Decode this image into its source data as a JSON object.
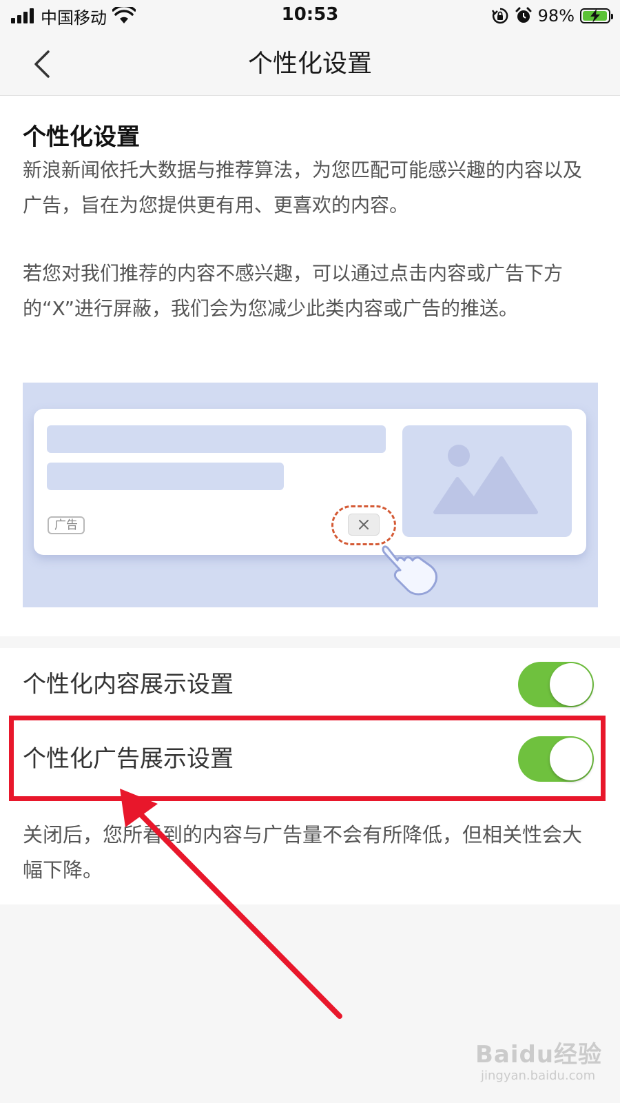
{
  "status_bar": {
    "carrier": "中国移动",
    "time": "10:53",
    "battery_percent": "98%",
    "battery_level": 0.98,
    "icons": [
      "signal-icon",
      "wifi-icon",
      "rotation-lock-icon",
      "alarm-icon",
      "battery-charging-icon"
    ]
  },
  "nav": {
    "title": "个性化设置",
    "back_icon": "chevron-left-icon"
  },
  "intro": {
    "title": "个性化设置",
    "paragraph1": "新浪新闻依托大数据与推荐算法，为您匹配可能感兴趣的内容以及广告，旨在为您提供更有用、更喜欢的内容。",
    "paragraph2": "若您对我们推荐的内容不感兴趣，可以通过点击内容或广告下方的“X”进行屏蔽，我们会为您减少此类内容或广告的推送。"
  },
  "illustration": {
    "ad_badge": "广告",
    "close_glyph": "×"
  },
  "settings": [
    {
      "label": "个性化内容展示设置",
      "enabled": true
    },
    {
      "label": "个性化广告展示设置",
      "enabled": true
    }
  ],
  "note": "关闭后，您所看到的内容与广告量不会有所降低，但相关性会大幅下降。",
  "watermark": {
    "brand": "Baidu经验",
    "url": "jingyan.baidu.com"
  },
  "colors": {
    "toggle_on": "#6fc13e",
    "highlight_red": "#e8172b",
    "illustration_bg": "#d2dbf2",
    "close_dash": "#d45a35"
  }
}
